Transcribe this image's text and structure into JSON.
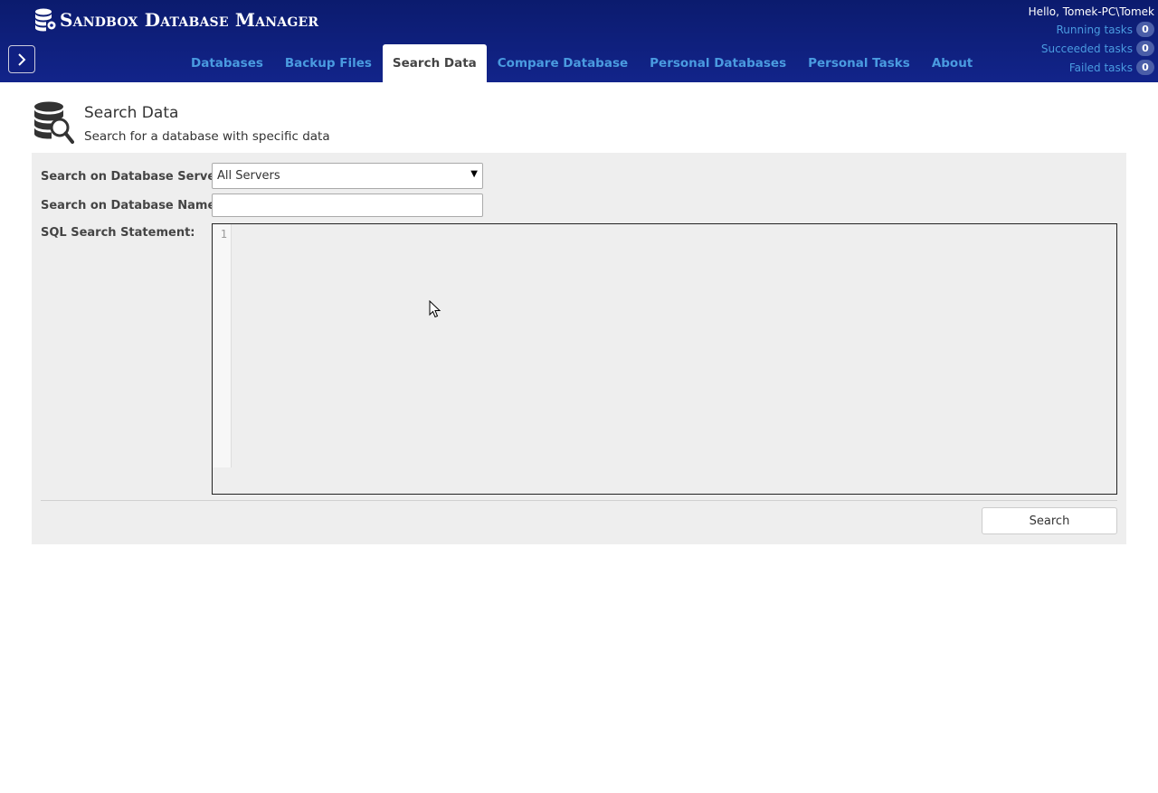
{
  "app": {
    "title": "Sandbox Database Manager",
    "icon": "database-gear-icon"
  },
  "nav": {
    "toggle_icon": "chevron-right-icon",
    "tabs": [
      {
        "label": "Databases",
        "active": false
      },
      {
        "label": "Backup Files",
        "active": false
      },
      {
        "label": "Search Data",
        "active": true
      },
      {
        "label": "Compare Database",
        "active": false
      },
      {
        "label": "Personal Databases",
        "active": false
      },
      {
        "label": "Personal Tasks",
        "active": false
      },
      {
        "label": "About",
        "active": false
      }
    ]
  },
  "user": {
    "greeting": "Hello, Tomek-PC\\Tomek",
    "tasks": [
      {
        "label": "Running tasks",
        "count": "0"
      },
      {
        "label": "Succeeded tasks",
        "count": "0"
      },
      {
        "label": "Failed tasks",
        "count": "0"
      }
    ]
  },
  "page": {
    "title": "Search Data",
    "subtitle": "Search for a database with specific data",
    "icon": "database-search-icon"
  },
  "form": {
    "server_label": "Search on Database Server:",
    "server_value": "All Servers",
    "name_label": "Search on Database Name:",
    "name_value": "",
    "sql_label": "SQL Search Statement:",
    "sql_line_number": "1",
    "sql_value": "",
    "search_button": "Search"
  },
  "colors": {
    "header_bg": "#0b1b6e",
    "tab_link": "#4a9be0",
    "panel_bg": "#eeeeee"
  }
}
